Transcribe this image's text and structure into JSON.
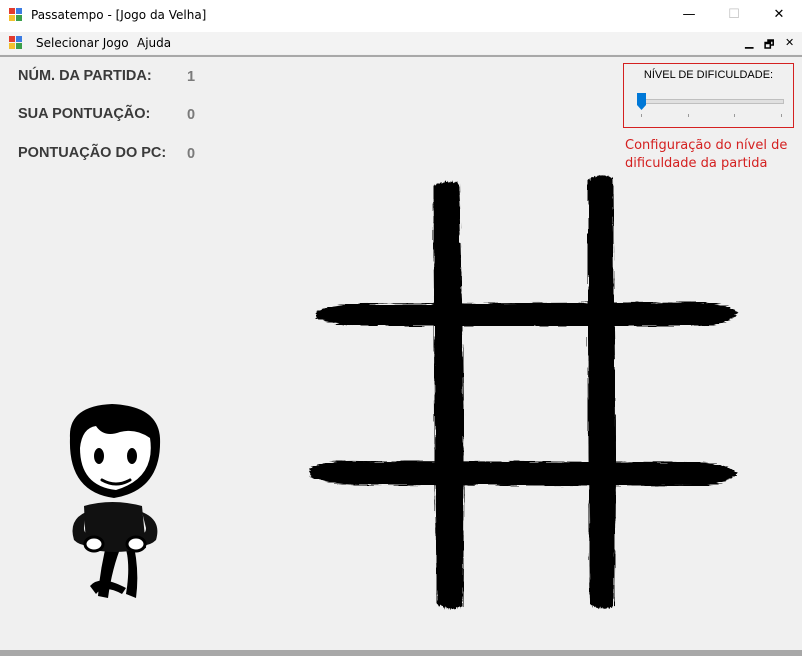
{
  "window": {
    "title": "Passatempo - [Jogo da Velha]",
    "minimize_icon": "minimize-icon",
    "maximize_icon": "maximize-icon",
    "close_icon": "close-icon",
    "minimize_glyph": "—",
    "maximize_glyph": "☐",
    "close_glyph": "✕"
  },
  "menu": {
    "items": [
      {
        "label": "Selecionar Jogo"
      },
      {
        "label": "Ajuda"
      }
    ],
    "mdi_minimize": "▁",
    "mdi_restore": "🗗",
    "mdi_close": "✕"
  },
  "stats": [
    {
      "label": "NÚM. DA PARTIDA:",
      "value": "1"
    },
    {
      "label": "SUA  PONTUAÇÃO:",
      "value": "0"
    },
    {
      "label": "PONTUAÇÃO DO PC:",
      "value": "0"
    }
  ],
  "difficulty": {
    "title": "NÍVEL DE DIFICULDADE:",
    "level": 0,
    "tick_count": 4
  },
  "annotation": "Configuração do nível de dificuldade da partida",
  "colors": {
    "annotation_red": "#d42020",
    "slider_blue": "#0078d7",
    "board_ink": "#000000"
  }
}
